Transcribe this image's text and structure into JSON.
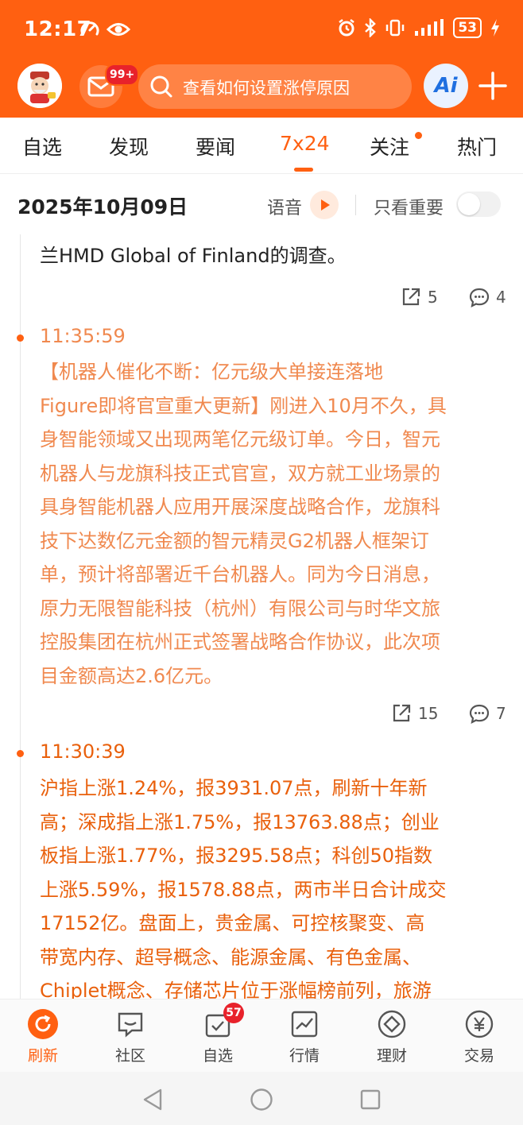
{
  "status": {
    "time": "12:17",
    "battery": "53"
  },
  "header": {
    "mail_badge": "99+",
    "search_placeholder": "查看如何设置涨停原因",
    "ai_label": "Ai"
  },
  "tabs": [
    {
      "label": "自选"
    },
    {
      "label": "发现"
    },
    {
      "label": "要闻"
    },
    {
      "label": "7x24"
    },
    {
      "label": "关注"
    },
    {
      "label": "热门"
    }
  ],
  "date_row": {
    "date": "2025年10月09日",
    "voice_label": "语音",
    "important_only_label": "只看重要"
  },
  "feed": {
    "items": [
      {
        "time": "",
        "lines": [
          "兰HMD Global of Finland的调查。"
        ],
        "share_count": "5",
        "comment_count": "4"
      },
      {
        "time": "11:35:59",
        "lines": [
          "【机器人催化不断：亿元级大单接连落地",
          "Figure即将官宣重大更新】刚进入10月不久，具",
          "身智能领域又出现两笔亿元级订单。今日，智元",
          "机器人与龙旗科技正式官宣，双方就工业场景的",
          "具身智能机器人应用开展深度战略合作，龙旗科",
          "技下达数亿元金额的智元精灵G2机器人框架订",
          "单，预计将部署近千台机器人。同为今日消息，",
          "原力无限智能科技（杭州）有限公司与时华文旅",
          "控股集团在杭州正式签署战略合作协议，此次项",
          "目金额高达2.6亿元。"
        ],
        "share_count": "15",
        "comment_count": "7"
      },
      {
        "time": "11:30:39",
        "lines": [
          "沪指上涨1.24%，报3931.07点，刷新十年新",
          "高；深成指上涨1.75%，报13763.88点；创业",
          "板指上涨1.77%，报3295.58点；科创50指数",
          "上涨5.59%，报1578.88点，两市半日合计成交",
          "17152亿。盘面上，贵金属、可控核聚变、高",
          "带宽内存、超导概念、能源金属、有色金属、",
          "Chiplet概念、存储芯片位于涨幅榜前列，旅游"
        ]
      }
    ]
  },
  "bottom_nav": [
    {
      "label": "刷新"
    },
    {
      "label": "社区"
    },
    {
      "label": "自选",
      "badge": "57"
    },
    {
      "label": "行情"
    },
    {
      "label": "理财"
    },
    {
      "label": "交易"
    }
  ],
  "colors": {
    "brand": "#ff6011",
    "news_orange": "#e9600c",
    "news_orange_light": "#f0894f"
  }
}
